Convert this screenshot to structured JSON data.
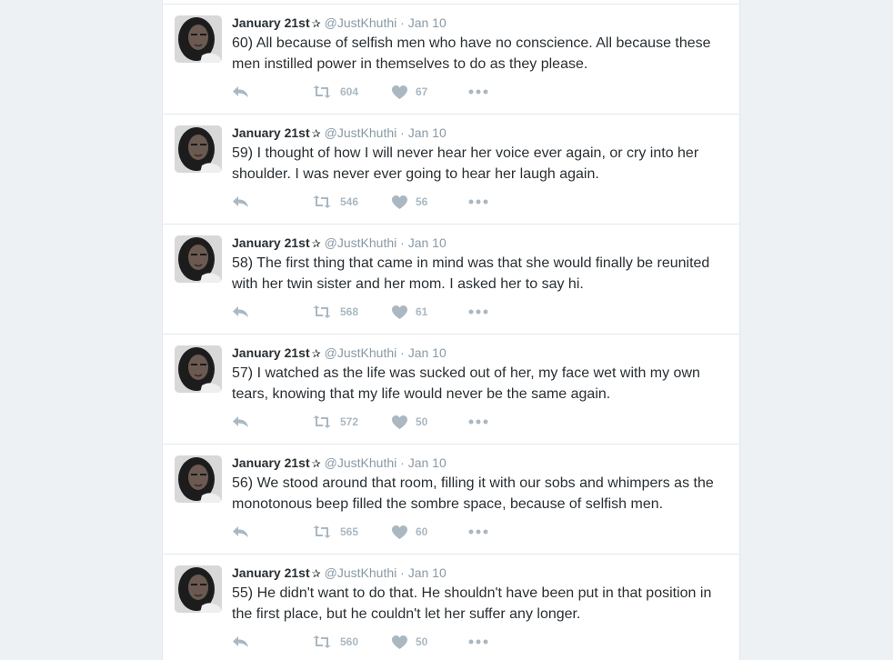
{
  "colors": {
    "name": "#292f33",
    "meta": "#8899a6",
    "action_icons": "#aab8c2",
    "divider": "#e1e8ed",
    "background": "#eef1f3"
  },
  "icons": {
    "reply": "reply-icon",
    "retweet": "retweet-icon",
    "like": "heart-icon",
    "more": "more-dots-icon",
    "badge": "star-icon"
  },
  "tweets": [
    {
      "name": "January 21st",
      "badge": "✰",
      "handle": "@JustKhuthi",
      "separator": "·",
      "date": "Jan 10",
      "text": "60) All because of selfish men who have no conscience. All because these men instilled power in themselves to do as they please.",
      "retweets": "604",
      "likes": "67"
    },
    {
      "name": "January 21st",
      "badge": "✰",
      "handle": "@JustKhuthi",
      "separator": "·",
      "date": "Jan 10",
      "text": "59) I thought of how I will never hear her voice ever again, or cry into her shoulder. I was never ever going to hear her laugh again.",
      "retweets": "546",
      "likes": "56"
    },
    {
      "name": "January 21st",
      "badge": "✰",
      "handle": "@JustKhuthi",
      "separator": "·",
      "date": "Jan 10",
      "text": "58) The first thing that came in mind was that she would finally be reunited with her twin sister and her mom. I asked her to say hi.",
      "retweets": "568",
      "likes": "61"
    },
    {
      "name": "January 21st",
      "badge": "✰",
      "handle": "@JustKhuthi",
      "separator": "·",
      "date": "Jan 10",
      "text": "57) I watched as the life was sucked out of her, my face wet with my own tears, knowing that my life would never be the same again.",
      "retweets": "572",
      "likes": "50"
    },
    {
      "name": "January 21st",
      "badge": "✰",
      "handle": "@JustKhuthi",
      "separator": "·",
      "date": "Jan 10",
      "text": "56) We stood around that room, filling it with our sobs and whimpers as the monotonous beep filled the sombre space, because of selfish men.",
      "retweets": "565",
      "likes": "60"
    },
    {
      "name": "January 21st",
      "badge": "✰",
      "handle": "@JustKhuthi",
      "separator": "·",
      "date": "Jan 10",
      "text": "55) He didn't want to do that. He shouldn't have been put in that position in the first place, but he couldn't let her suffer any longer.",
      "retweets": "560",
      "likes": "50"
    }
  ]
}
